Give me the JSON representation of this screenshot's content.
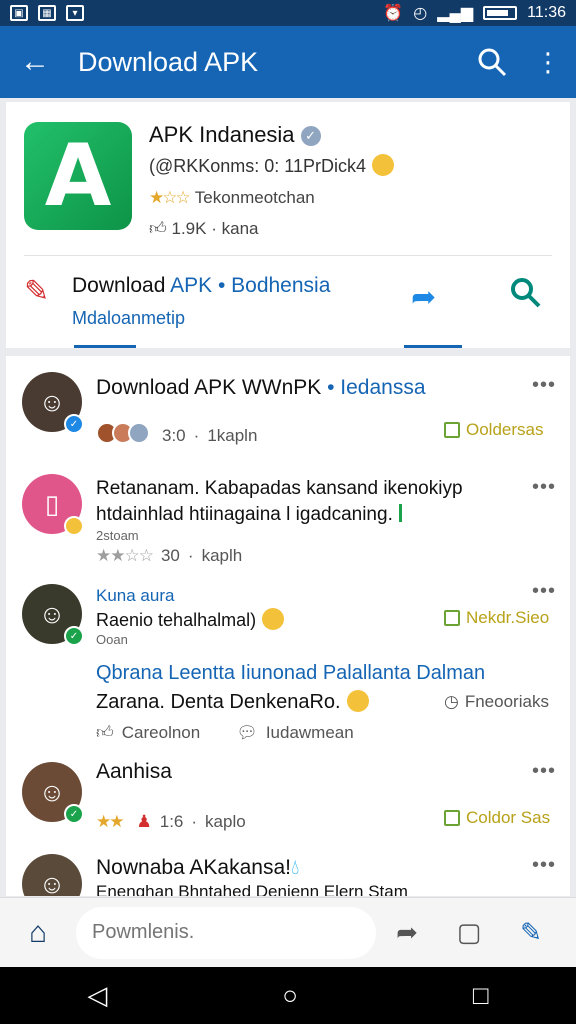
{
  "status_bar": {
    "time": "11:36"
  },
  "app_bar": {
    "title": "Download APK"
  },
  "app_card": {
    "name": "APK Indanesia",
    "subtitle": "(@RKKonms: 0: 11PrDick4",
    "rating_text": "Tekonmeotchan",
    "downloads": "1.9K",
    "downloads_suffix": "kana",
    "download_title_plain": "Download",
    "download_title_blue": "APK • Bodhensia",
    "download_subtitle": "Mdaloanmetip"
  },
  "feed": [
    {
      "title_plain": "Download APK WWnPK",
      "title_blue": "• Iedanssa",
      "meta_count": "3:0",
      "meta_time": "1kapln",
      "tag": "Ooldersas"
    },
    {
      "line1": "Retananam. Kabapadas kansand ikenokiyp",
      "line2": "htdainhlad htiinagaina l igadcaning.",
      "small": "2stoam",
      "meta_count": "30",
      "meta_time": "kaplh"
    },
    {
      "name": "Kuna aura",
      "line1": "Raenio tehalhalmal)",
      "small": "Ooan",
      "tag": "Nekdr.Sieo",
      "headline": "Qbrana Leentta Iiunonad Palallanta Dalman",
      "line2": "Zarana. Denta DenkenaRo.",
      "status": "Fneooriaks",
      "action1": "Careolnon",
      "action2": "Iudawmean"
    },
    {
      "name": "Aanhisa",
      "meta_count": "1:6",
      "meta_time": "kaplo",
      "tag": "Coldor Sas"
    },
    {
      "name": "Nownaba AKakansa!",
      "line1": "Enenghan Bhntahed Denienn Elern Stam"
    }
  ],
  "bottom_bar": {
    "placeholder": "Powmlenis."
  },
  "colors": {
    "primary": "#1565b4",
    "status_bar": "#123a66",
    "accent_green": "#1aa34a",
    "tag_gold": "#b8a21a"
  }
}
